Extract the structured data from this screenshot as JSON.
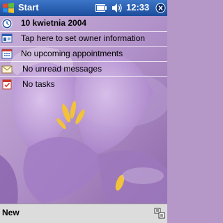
{
  "titlebar": {
    "start_label": "Start",
    "clock": "12:33",
    "icons": [
      "windows-flag-icon",
      "battery-icon",
      "volume-icon",
      "ok-icon"
    ]
  },
  "today": {
    "date": "10 kwietnia 2004",
    "owner": "Tap here to set owner information",
    "appointments": "No upcoming appointments",
    "messages": "No unread messages",
    "tasks": "No tasks"
  },
  "menubar": {
    "new_label": "New",
    "input_icon": "input-panel-icon"
  },
  "colors": {
    "titlebar_blue": "#2456a8",
    "wallpaper_purple": "#b597c8",
    "menubar_gray": "#dcdcdc"
  }
}
